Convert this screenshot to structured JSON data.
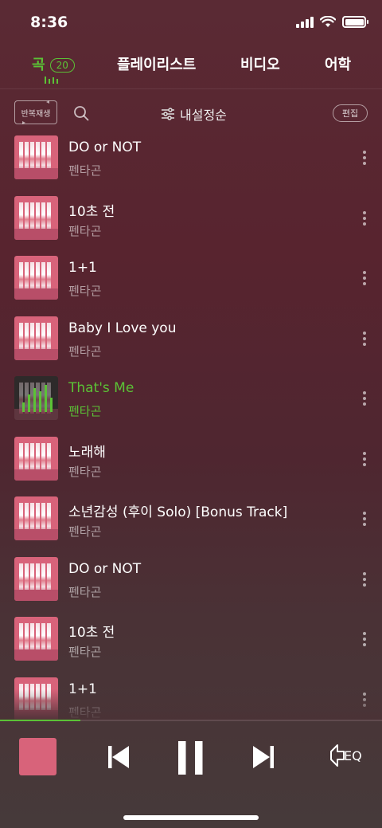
{
  "status": {
    "time": "8:36"
  },
  "tabs": [
    {
      "label": "곡",
      "count": "20",
      "active": true
    },
    {
      "label": "플레이리스트"
    },
    {
      "label": "비디오"
    },
    {
      "label": "어학"
    }
  ],
  "toolbar": {
    "repeat_label": "반복재생",
    "sort_label": "내설정순",
    "edit_label": "편집"
  },
  "songs": [
    {
      "title": "DO or NOT",
      "artist": "펜타곤"
    },
    {
      "title": "10초 전",
      "artist": "펜타곤"
    },
    {
      "title": "1+1",
      "artist": "펜타곤"
    },
    {
      "title": "Baby I Love you",
      "artist": "펜타곤"
    },
    {
      "title": "That's Me",
      "artist": "펜타곤",
      "playing": true
    },
    {
      "title": "노래해",
      "artist": "펜타곤"
    },
    {
      "title": "소년감성 (후이 Solo) [Bonus Track]",
      "artist": "펜타곤"
    },
    {
      "title": "DO or NOT",
      "artist": "펜타곤"
    },
    {
      "title": "10초 전",
      "artist": "펜타곤"
    },
    {
      "title": "1+1",
      "artist": "펜타곤"
    }
  ],
  "player": {
    "progress": 0.21,
    "eq_label": "EQ"
  },
  "colors": {
    "accent": "#5bc236",
    "background": "#5a2a34",
    "album_pink": "#d8637a"
  },
  "icons": [
    "search-icon",
    "sort-icon",
    "more-icon",
    "previous-icon",
    "pause-icon",
    "next-icon",
    "eq-icon",
    "repeat-icon"
  ]
}
